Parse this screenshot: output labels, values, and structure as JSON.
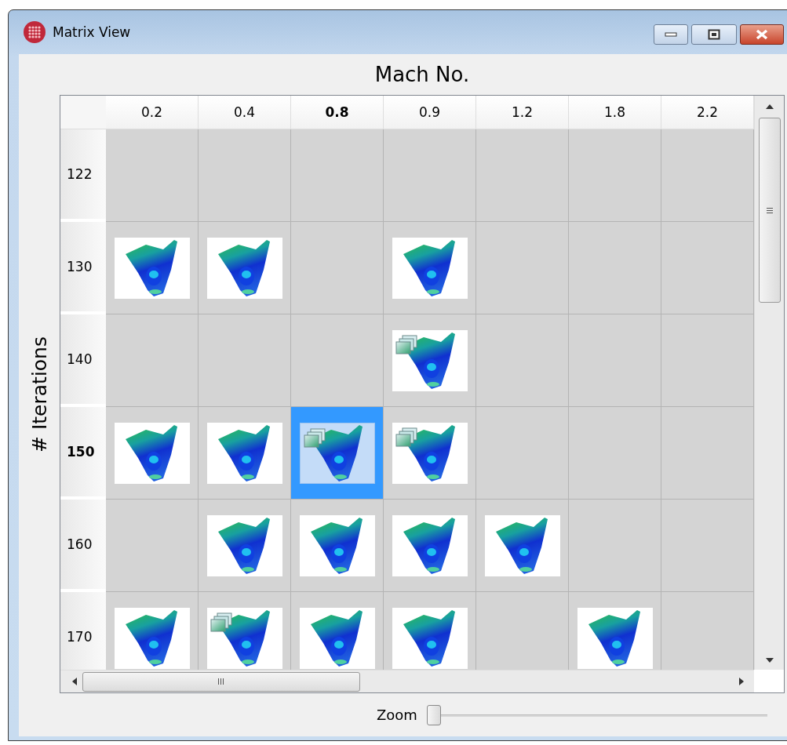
{
  "window": {
    "title": "Matrix View"
  },
  "matrix": {
    "x_axis_title": "Mach No.",
    "y_axis_title": "# Iterations",
    "columns": [
      {
        "label": "0.2",
        "selected": false
      },
      {
        "label": "0.4",
        "selected": false
      },
      {
        "label": "0.8",
        "selected": true
      },
      {
        "label": "0.9",
        "selected": false
      },
      {
        "label": "1.2",
        "selected": false
      },
      {
        "label": "1.8",
        "selected": false
      },
      {
        "label": "2.2",
        "selected": false
      }
    ],
    "rows": [
      {
        "label": "122",
        "selected": false,
        "cells": [
          {
            "has_plot": false,
            "multiple": false,
            "selected": false
          },
          {
            "has_plot": false,
            "multiple": false,
            "selected": false
          },
          {
            "has_plot": false,
            "multiple": false,
            "selected": false
          },
          {
            "has_plot": false,
            "multiple": false,
            "selected": false
          },
          {
            "has_plot": false,
            "multiple": false,
            "selected": false
          },
          {
            "has_plot": false,
            "multiple": false,
            "selected": false
          },
          {
            "has_plot": false,
            "multiple": false,
            "selected": false
          }
        ]
      },
      {
        "label": "130",
        "selected": false,
        "cells": [
          {
            "has_plot": true,
            "multiple": false,
            "selected": false
          },
          {
            "has_plot": true,
            "multiple": false,
            "selected": false
          },
          {
            "has_plot": false,
            "multiple": false,
            "selected": false
          },
          {
            "has_plot": true,
            "multiple": false,
            "selected": false
          },
          {
            "has_plot": false,
            "multiple": false,
            "selected": false
          },
          {
            "has_plot": false,
            "multiple": false,
            "selected": false
          },
          {
            "has_plot": false,
            "multiple": false,
            "selected": false
          }
        ]
      },
      {
        "label": "140",
        "selected": false,
        "cells": [
          {
            "has_plot": false,
            "multiple": false,
            "selected": false
          },
          {
            "has_plot": false,
            "multiple": false,
            "selected": false
          },
          {
            "has_plot": false,
            "multiple": false,
            "selected": false
          },
          {
            "has_plot": true,
            "multiple": true,
            "selected": false
          },
          {
            "has_plot": false,
            "multiple": false,
            "selected": false
          },
          {
            "has_plot": false,
            "multiple": false,
            "selected": false
          },
          {
            "has_plot": false,
            "multiple": false,
            "selected": false
          }
        ]
      },
      {
        "label": "150",
        "selected": true,
        "cells": [
          {
            "has_plot": true,
            "multiple": false,
            "selected": false
          },
          {
            "has_plot": true,
            "multiple": false,
            "selected": false
          },
          {
            "has_plot": true,
            "multiple": true,
            "selected": true
          },
          {
            "has_plot": true,
            "multiple": true,
            "selected": false
          },
          {
            "has_plot": false,
            "multiple": false,
            "selected": false
          },
          {
            "has_plot": false,
            "multiple": false,
            "selected": false
          },
          {
            "has_plot": false,
            "multiple": false,
            "selected": false
          }
        ]
      },
      {
        "label": "160",
        "selected": false,
        "cells": [
          {
            "has_plot": false,
            "multiple": false,
            "selected": false
          },
          {
            "has_plot": true,
            "multiple": false,
            "selected": false
          },
          {
            "has_plot": true,
            "multiple": false,
            "selected": false
          },
          {
            "has_plot": true,
            "multiple": false,
            "selected": false
          },
          {
            "has_plot": true,
            "multiple": false,
            "selected": false
          },
          {
            "has_plot": false,
            "multiple": false,
            "selected": false
          },
          {
            "has_plot": false,
            "multiple": false,
            "selected": false
          }
        ]
      },
      {
        "label": "170",
        "selected": false,
        "cells": [
          {
            "has_plot": true,
            "multiple": false,
            "selected": false
          },
          {
            "has_plot": true,
            "multiple": true,
            "selected": false
          },
          {
            "has_plot": true,
            "multiple": false,
            "selected": false
          },
          {
            "has_plot": true,
            "multiple": false,
            "selected": false
          },
          {
            "has_plot": false,
            "multiple": false,
            "selected": false
          },
          {
            "has_plot": true,
            "multiple": false,
            "selected": false
          },
          {
            "has_plot": false,
            "multiple": false,
            "selected": false
          }
        ]
      }
    ]
  },
  "zoom": {
    "label": "Zoom",
    "level": 0
  }
}
